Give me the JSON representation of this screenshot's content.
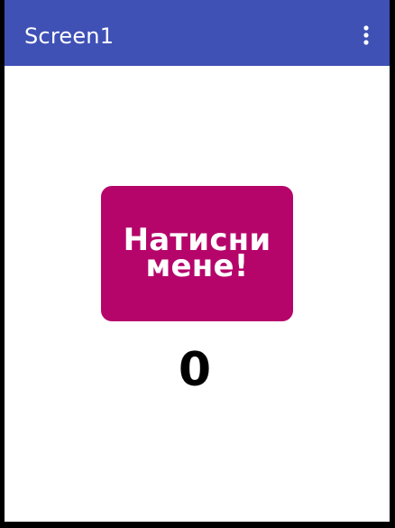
{
  "app_bar": {
    "title": "Screen1",
    "menu_icon": "vertical-ellipsis-icon",
    "background_color": "#3f51b5",
    "text_color": "#ffffff"
  },
  "main": {
    "button_label": "Натисни мене!",
    "button_color": "#b5056b",
    "counter_value": "0"
  }
}
